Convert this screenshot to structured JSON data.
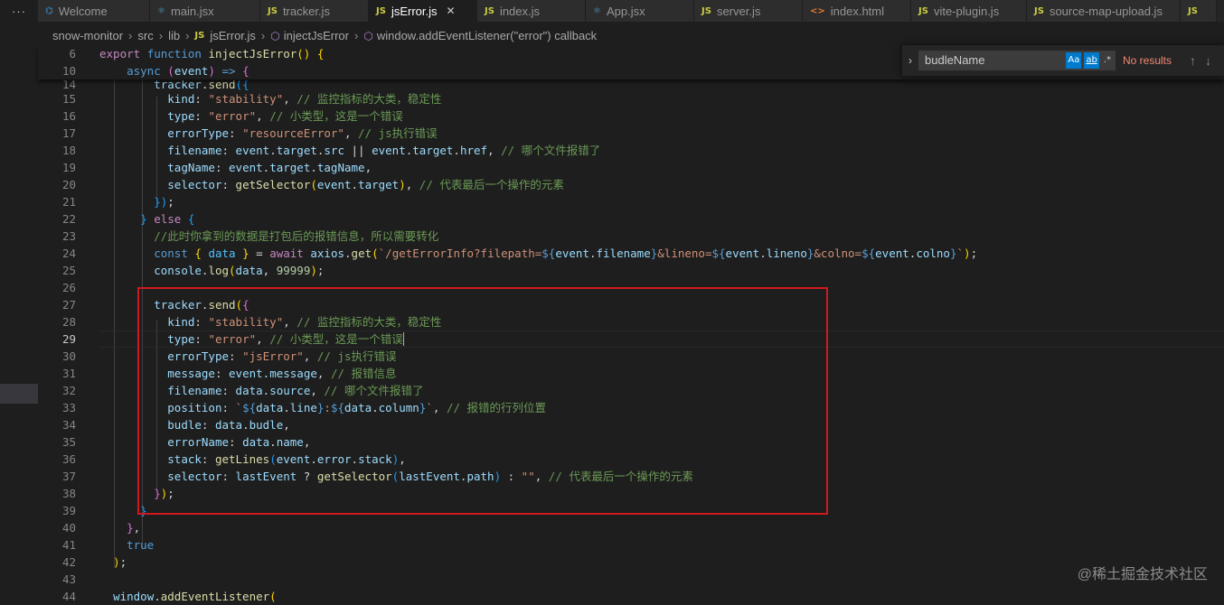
{
  "tabs": [
    {
      "label": "Welcome",
      "type": "vsc"
    },
    {
      "label": "main.jsx",
      "type": "react"
    },
    {
      "label": "tracker.js",
      "type": "js"
    },
    {
      "label": "jsError.js",
      "type": "js",
      "active": true
    },
    {
      "label": "index.js",
      "type": "js"
    },
    {
      "label": "App.jsx",
      "type": "react"
    },
    {
      "label": "server.js",
      "type": "js"
    },
    {
      "label": "index.html",
      "type": "html"
    },
    {
      "label": "vite-plugin.js",
      "type": "js"
    },
    {
      "label": "source-map-upload.js",
      "type": "js"
    },
    {
      "label": "JS",
      "type": "js"
    }
  ],
  "tab_icon_js": "JS",
  "tab_close": "✕",
  "more_actions": "···",
  "breadcrumb": {
    "p1": "snow-monitor",
    "p2": "src",
    "p3": "lib",
    "p4": "jsError.js",
    "p5": "injectJsError",
    "p6": "window.addEventListener(\"error\") callback",
    "sep": "›"
  },
  "find": {
    "query": "budleName",
    "match_case": "Aa",
    "whole_word": "ab",
    "regex": ".*",
    "result": "No results"
  },
  "line_numbers": [
    "6",
    "10",
    "14",
    "15",
    "16",
    "17",
    "18",
    "19",
    "20",
    "21",
    "22",
    "23",
    "24",
    "25",
    "26",
    "27",
    "28",
    "29",
    "30",
    "31",
    "32",
    "33",
    "34",
    "35",
    "36",
    "37",
    "38",
    "39",
    "40",
    "41",
    "42",
    "43",
    "44"
  ],
  "watermark": "@稀土掘金技术社区"
}
